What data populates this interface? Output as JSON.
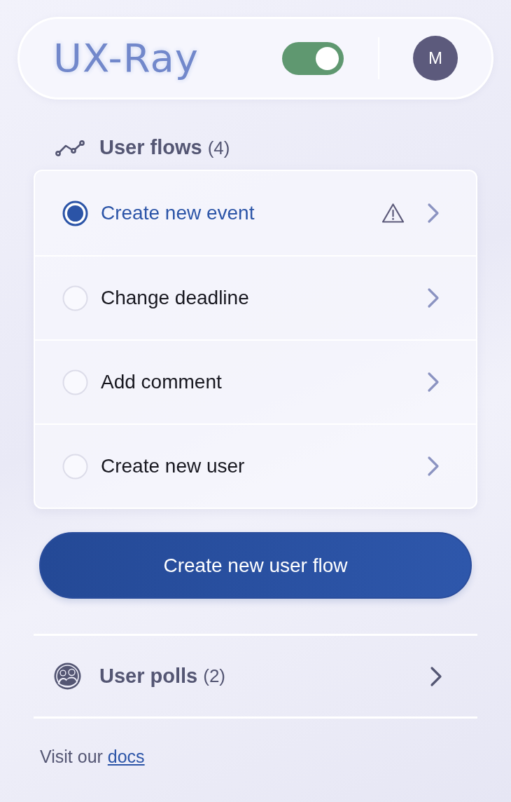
{
  "header": {
    "logo": "UX-Ray",
    "toggle": {
      "on": true
    },
    "avatar": {
      "initial": "M"
    }
  },
  "user_flows": {
    "title": "User flows",
    "count": "(4)",
    "items": [
      {
        "label": "Create new event",
        "selected": true,
        "warning": true
      },
      {
        "label": "Change deadline",
        "selected": false,
        "warning": false
      },
      {
        "label": "Add comment",
        "selected": false,
        "warning": false
      },
      {
        "label": "Create new user",
        "selected": false,
        "warning": false
      }
    ]
  },
  "create_button": {
    "label": "Create new user flow"
  },
  "user_polls": {
    "title": "User polls",
    "count": "(2)"
  },
  "footer": {
    "text": "Visit our",
    "link": "docs"
  }
}
